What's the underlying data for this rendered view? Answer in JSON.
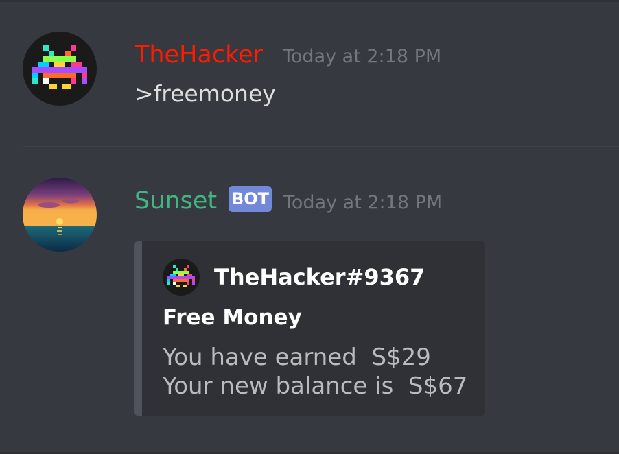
{
  "messages": [
    {
      "username": "TheHacker",
      "username_color": "#ff1a00",
      "timestamp": "Today at 2:18 PM",
      "content": ">freemoney",
      "avatar_icon": "space-invader-icon"
    },
    {
      "username": "Sunset",
      "username_color": "#43b581",
      "tag": "BOT",
      "tag_color": "#7289da",
      "timestamp": "Today at 2:18 PM",
      "avatar_icon": "sunset-avatar-icon",
      "embed": {
        "author_name": "TheHacker#9367",
        "title": "Free Money",
        "lines": [
          "You have earned  S$29",
          "Your new balance is  S$67"
        ]
      }
    }
  ]
}
